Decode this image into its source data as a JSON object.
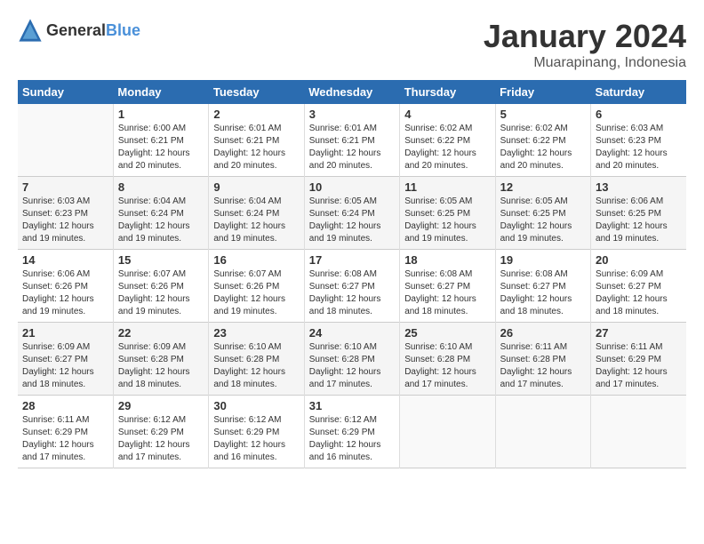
{
  "header": {
    "logo_general": "General",
    "logo_blue": "Blue",
    "month_title": "January 2024",
    "location": "Muarapinang, Indonesia"
  },
  "days_of_week": [
    "Sunday",
    "Monday",
    "Tuesday",
    "Wednesday",
    "Thursday",
    "Friday",
    "Saturday"
  ],
  "weeks": [
    [
      {
        "day": "",
        "info": ""
      },
      {
        "day": "1",
        "info": "Sunrise: 6:00 AM\nSunset: 6:21 PM\nDaylight: 12 hours\nand 20 minutes."
      },
      {
        "day": "2",
        "info": "Sunrise: 6:01 AM\nSunset: 6:21 PM\nDaylight: 12 hours\nand 20 minutes."
      },
      {
        "day": "3",
        "info": "Sunrise: 6:01 AM\nSunset: 6:21 PM\nDaylight: 12 hours\nand 20 minutes."
      },
      {
        "day": "4",
        "info": "Sunrise: 6:02 AM\nSunset: 6:22 PM\nDaylight: 12 hours\nand 20 minutes."
      },
      {
        "day": "5",
        "info": "Sunrise: 6:02 AM\nSunset: 6:22 PM\nDaylight: 12 hours\nand 20 minutes."
      },
      {
        "day": "6",
        "info": "Sunrise: 6:03 AM\nSunset: 6:23 PM\nDaylight: 12 hours\nand 20 minutes."
      }
    ],
    [
      {
        "day": "7",
        "info": "Sunrise: 6:03 AM\nSunset: 6:23 PM\nDaylight: 12 hours\nand 19 minutes."
      },
      {
        "day": "8",
        "info": "Sunrise: 6:04 AM\nSunset: 6:24 PM\nDaylight: 12 hours\nand 19 minutes."
      },
      {
        "day": "9",
        "info": "Sunrise: 6:04 AM\nSunset: 6:24 PM\nDaylight: 12 hours\nand 19 minutes."
      },
      {
        "day": "10",
        "info": "Sunrise: 6:05 AM\nSunset: 6:24 PM\nDaylight: 12 hours\nand 19 minutes."
      },
      {
        "day": "11",
        "info": "Sunrise: 6:05 AM\nSunset: 6:25 PM\nDaylight: 12 hours\nand 19 minutes."
      },
      {
        "day": "12",
        "info": "Sunrise: 6:05 AM\nSunset: 6:25 PM\nDaylight: 12 hours\nand 19 minutes."
      },
      {
        "day": "13",
        "info": "Sunrise: 6:06 AM\nSunset: 6:25 PM\nDaylight: 12 hours\nand 19 minutes."
      }
    ],
    [
      {
        "day": "14",
        "info": "Sunrise: 6:06 AM\nSunset: 6:26 PM\nDaylight: 12 hours\nand 19 minutes."
      },
      {
        "day": "15",
        "info": "Sunrise: 6:07 AM\nSunset: 6:26 PM\nDaylight: 12 hours\nand 19 minutes."
      },
      {
        "day": "16",
        "info": "Sunrise: 6:07 AM\nSunset: 6:26 PM\nDaylight: 12 hours\nand 19 minutes."
      },
      {
        "day": "17",
        "info": "Sunrise: 6:08 AM\nSunset: 6:27 PM\nDaylight: 12 hours\nand 18 minutes."
      },
      {
        "day": "18",
        "info": "Sunrise: 6:08 AM\nSunset: 6:27 PM\nDaylight: 12 hours\nand 18 minutes."
      },
      {
        "day": "19",
        "info": "Sunrise: 6:08 AM\nSunset: 6:27 PM\nDaylight: 12 hours\nand 18 minutes."
      },
      {
        "day": "20",
        "info": "Sunrise: 6:09 AM\nSunset: 6:27 PM\nDaylight: 12 hours\nand 18 minutes."
      }
    ],
    [
      {
        "day": "21",
        "info": "Sunrise: 6:09 AM\nSunset: 6:27 PM\nDaylight: 12 hours\nand 18 minutes."
      },
      {
        "day": "22",
        "info": "Sunrise: 6:09 AM\nSunset: 6:28 PM\nDaylight: 12 hours\nand 18 minutes."
      },
      {
        "day": "23",
        "info": "Sunrise: 6:10 AM\nSunset: 6:28 PM\nDaylight: 12 hours\nand 18 minutes."
      },
      {
        "day": "24",
        "info": "Sunrise: 6:10 AM\nSunset: 6:28 PM\nDaylight: 12 hours\nand 17 minutes."
      },
      {
        "day": "25",
        "info": "Sunrise: 6:10 AM\nSunset: 6:28 PM\nDaylight: 12 hours\nand 17 minutes."
      },
      {
        "day": "26",
        "info": "Sunrise: 6:11 AM\nSunset: 6:28 PM\nDaylight: 12 hours\nand 17 minutes."
      },
      {
        "day": "27",
        "info": "Sunrise: 6:11 AM\nSunset: 6:29 PM\nDaylight: 12 hours\nand 17 minutes."
      }
    ],
    [
      {
        "day": "28",
        "info": "Sunrise: 6:11 AM\nSunset: 6:29 PM\nDaylight: 12 hours\nand 17 minutes."
      },
      {
        "day": "29",
        "info": "Sunrise: 6:12 AM\nSunset: 6:29 PM\nDaylight: 12 hours\nand 17 minutes."
      },
      {
        "day": "30",
        "info": "Sunrise: 6:12 AM\nSunset: 6:29 PM\nDaylight: 12 hours\nand 16 minutes."
      },
      {
        "day": "31",
        "info": "Sunrise: 6:12 AM\nSunset: 6:29 PM\nDaylight: 12 hours\nand 16 minutes."
      },
      {
        "day": "",
        "info": ""
      },
      {
        "day": "",
        "info": ""
      },
      {
        "day": "",
        "info": ""
      }
    ]
  ]
}
